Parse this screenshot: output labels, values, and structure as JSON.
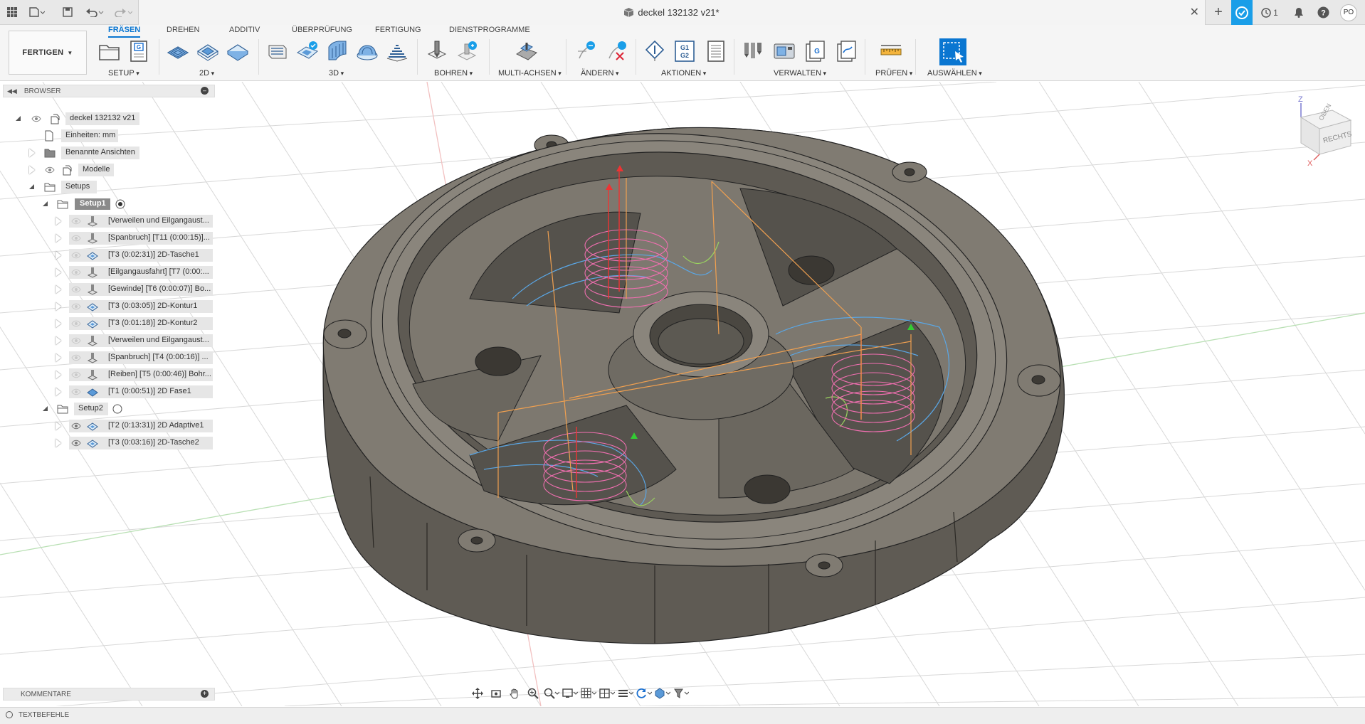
{
  "titlebar": {
    "document_title": "deckel 132132 v21*",
    "job_count": "1",
    "user_initials": "PO"
  },
  "ribbon": {
    "workspace": "FERTIGEN",
    "tabs": [
      "FRÄSEN",
      "DREHEN",
      "ADDITIV",
      "ÜBERPRÜFUNG",
      "FERTIGUNG",
      "DIENSTPROGRAMME"
    ],
    "active_tab": "FRÄSEN",
    "groups": [
      "SETUP",
      "2D",
      "3D",
      "BOHREN",
      "MULTI-ACHSEN",
      "ÄNDERN",
      "AKTIONEN",
      "VERWALTEN",
      "PRÜFEN",
      "AUSWÄHLEN"
    ],
    "post_icon_text": "G",
    "nc_icon_text": "G1 G2"
  },
  "browser": {
    "header": "BROWSER",
    "root": "deckel 132132 v21",
    "units": "Einheiten: mm",
    "named_views": "Benannte Ansichten",
    "models": "Modelle",
    "setups": "Setups",
    "setup1": "Setup1",
    "setup1_ops": [
      "[Verweilen und Eilgangaust...",
      "[Spanbruch] [T11 (0:00:15)]...",
      "[T3 (0:02:31)] 2D-Tasche1",
      "[Eilgangausfahrt] [T7 (0:00:...",
      "[Gewinde] [T6 (0:00:07)] Bo...",
      "[T3 (0:03:05)] 2D-Kontur1",
      "[T3 (0:01:18)] 2D-Kontur2",
      "[Verweilen und Eilgangaust...",
      "[Spanbruch] [T4 (0:00:16)] ...",
      "[Reiben] [T5 (0:00:46)] Bohr...",
      "[T1 (0:00:51)] 2D Fase1"
    ],
    "setup2": "Setup2",
    "setup2_ops": [
      "[T2 (0:13:31)] 2D Adaptive1",
      "[T3 (0:03:16)] 2D-Tasche2"
    ]
  },
  "comments_label": "KOMMENTARE",
  "textcommands_label": "TEXTBEFEHLE",
  "viewcube": {
    "top": "OBEN",
    "right": "RECHTS",
    "axis_z": "Z",
    "axis_x": "X"
  },
  "colors": {
    "accent": "#0a76d1",
    "part_body": "#6f6b63",
    "toolpath_pink": "#f06fb0",
    "toolpath_blue": "#5aa7e6",
    "toolpath_orange": "#f0a050"
  }
}
